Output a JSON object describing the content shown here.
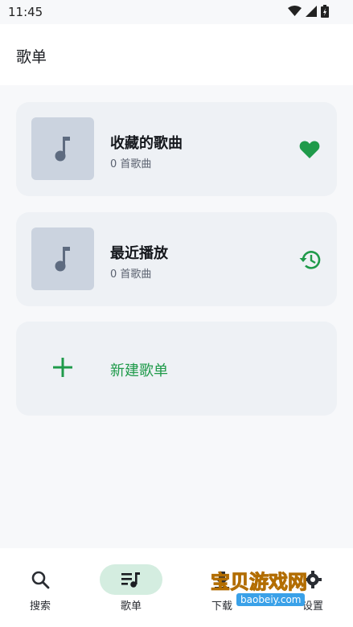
{
  "status_bar": {
    "time": "11:45"
  },
  "app_bar": {
    "title": "歌单"
  },
  "playlists": [
    {
      "name": "收藏的歌曲",
      "count": "0 首歌曲",
      "action_icon": "heart-icon"
    },
    {
      "name": "最近播放",
      "count": "0 首歌曲",
      "action_icon": "history-icon"
    }
  ],
  "new_playlist": {
    "label": "新建歌单"
  },
  "bottom_nav": [
    {
      "label": "搜索",
      "icon": "search-icon",
      "active": false
    },
    {
      "label": "歌单",
      "icon": "playlist-icon",
      "active": true
    },
    {
      "label": "下载",
      "icon": "download-icon",
      "active": false
    },
    {
      "label": "设置",
      "icon": "gear-icon",
      "active": false
    }
  ],
  "watermark": {
    "title": "宝贝游戏网",
    "url": "baobeiy.com"
  },
  "colors": {
    "accent": "#1f9a4a",
    "card_bg": "#eef1f5",
    "thumb_bg": "#cbd3df"
  }
}
